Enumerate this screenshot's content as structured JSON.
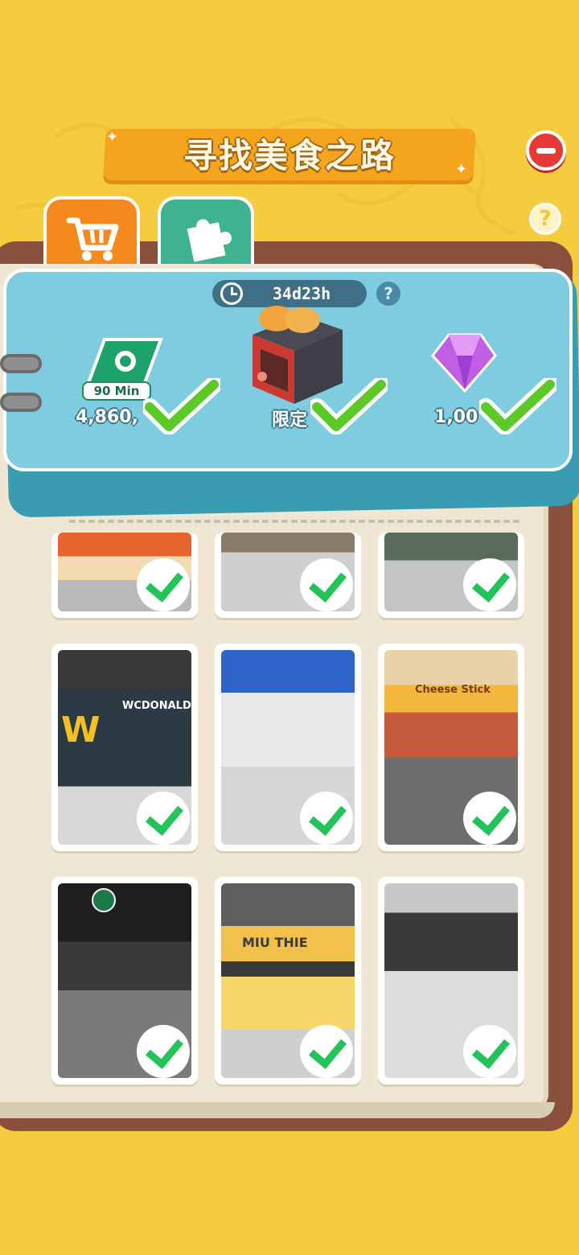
{
  "header": {
    "title": "寻找美食之路"
  },
  "tabs": [
    {
      "icon": "shopping-cart-icon"
    },
    {
      "icon": "puzzle-piece-icon"
    }
  ],
  "event": {
    "timer": "34d23h",
    "timer_help": "?",
    "rewards": [
      {
        "icon": "speedup-ticket-icon",
        "badge": "90 Min",
        "label": "4,860,",
        "claimed": true
      },
      {
        "icon": "toaster-oven-icon",
        "label": "限定",
        "claimed": true
      },
      {
        "icon": "gem-icon",
        "label": "1,00",
        "claimed": true
      }
    ]
  },
  "help": "?",
  "cards": [
    {
      "sign": "",
      "claimed": true
    },
    {
      "sign": "",
      "claimed": true
    },
    {
      "sign": "",
      "claimed": true
    },
    {
      "sign": "WCDONALD",
      "claimed": true
    },
    {
      "sign": "",
      "claimed": true
    },
    {
      "sign": "Cheese Stick",
      "claimed": true
    },
    {
      "sign": "",
      "claimed": true
    },
    {
      "sign": "MIU THIE",
      "claimed": true
    },
    {
      "sign": "",
      "claimed": true
    }
  ]
}
